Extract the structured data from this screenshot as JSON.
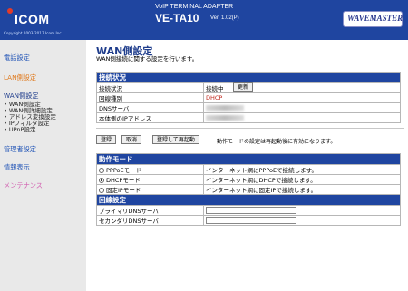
{
  "header": {
    "logo_text": "ICOM",
    "copyright": "Copyright 2003-2017 Icom Inc.",
    "product_subtitle": "VoIP TERMINAL ADAPTER",
    "product_title": "VE-TA10",
    "version": "Ver. 1.02(P)",
    "brand": "WAVEMASTER"
  },
  "sidebar": {
    "items": [
      {
        "label": "電話設定"
      },
      {
        "label": "LAN側設定"
      },
      {
        "label": "WAN側設定"
      },
      {
        "label": "管理者設定"
      },
      {
        "label": "情報表示"
      },
      {
        "label": "メンテナンス"
      }
    ],
    "sub_items": [
      {
        "label": "WAN側設定"
      },
      {
        "label": "WAN側詳細設定"
      },
      {
        "label": "アドレス変換設定"
      },
      {
        "label": "IPフィルタ設定"
      },
      {
        "label": "UPnP設定"
      }
    ]
  },
  "main": {
    "title": "WAN側設定",
    "description": "WAN側接続に関する設定を行います。",
    "status": {
      "header": "接続状況",
      "rows": [
        {
          "label": "接続状況",
          "value": "接続中"
        },
        {
          "label": "回線種別",
          "value": "DHCP"
        },
        {
          "label": "DNSサーバ",
          "value": ""
        },
        {
          "label": "本体側のIPアドレス",
          "value": ""
        }
      ],
      "update_button": "更新"
    },
    "buttons": {
      "register": "登録",
      "cancel": "取消",
      "register_restart": "登録して再起動",
      "note": "動作モードの設定は再起動後に有効になります。"
    },
    "mode": {
      "header": "動作モード",
      "options": [
        {
          "label": "PPPoEモード",
          "desc": "インターネット網にPPPoEで接続します。",
          "selected": false
        },
        {
          "label": "DHCPモード",
          "desc": "インターネット網にDHCPで接続します。",
          "selected": true
        },
        {
          "label": "固定IPモード",
          "desc": "インターネット網に固定IPで接続します。",
          "selected": false
        }
      ]
    },
    "line": {
      "header": "回線設定",
      "rows": [
        {
          "label": "プライマリDNSサーバ",
          "value": ""
        },
        {
          "label": "セカンダリDNSサーバ",
          "value": ""
        }
      ]
    }
  },
  "colors": {
    "header_bg": "#1f45a0",
    "accent_red": "#c0281e",
    "nav_blue": "#2456b7",
    "nav_orange": "#e07b20",
    "nav_pink": "#d260b0"
  }
}
